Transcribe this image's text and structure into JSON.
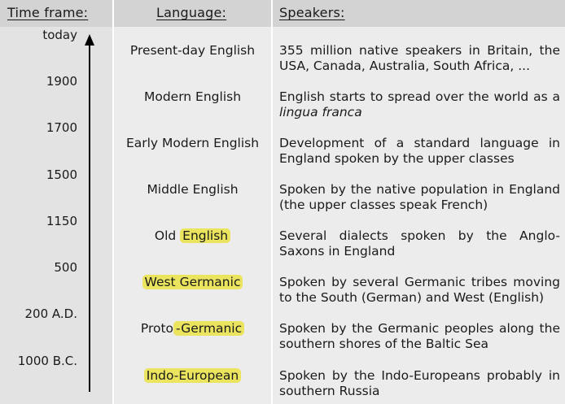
{
  "header": {
    "time_frame": "Time frame:",
    "language": "Language:",
    "speakers": "Speakers:"
  },
  "timeline": [
    "today",
    "1900",
    "1700",
    "1500",
    "1150",
    "500",
    "200 A.D.",
    "1000 B.C."
  ],
  "rows": [
    {
      "language_pre": "Present-day English",
      "language_hl": "",
      "speakers_line1": "355 million native speakers in Britain, the",
      "speakers_line2": "USA, Canada, Australia, South Africa, ..."
    },
    {
      "language_pre": "Modern English",
      "language_hl": "",
      "speakers_line1": "English starts to spread over the world as a",
      "speakers_line2": "lingua franca"
    },
    {
      "language_pre": "Early Modern English",
      "language_hl": "",
      "speakers_line1": "Development of a standard language in",
      "speakers_line2": "England spoken by the upper classes"
    },
    {
      "language_pre": "Middle English",
      "language_hl": "",
      "speakers_line1": "Spoken by the native population in England",
      "speakers_line2": "(the upper classes speak French)"
    },
    {
      "language_pre": "Old ",
      "language_hl": "English",
      "speakers_line1": "Several dialects spoken by the Anglo-",
      "speakers_line2": "Saxons in England"
    },
    {
      "language_pre": "",
      "language_hl": "West Germanic",
      "speakers_line1": "Spoken by several Germanic tribes moving",
      "speakers_line2": "to the South (German) and West (English)"
    },
    {
      "language_pre": "Proto",
      "language_hl": "-Germanic",
      "speakers_line1": "Spoken by the Germanic peoples along the",
      "speakers_line2": "southern shores of the Baltic Sea"
    },
    {
      "language_pre": "",
      "language_hl": "Indo-European",
      "speakers_line1": "Spoken by the Indo-Europeans probably in",
      "speakers_line2": "southern Russia"
    }
  ],
  "colors": {
    "highlight": "#ebe45e",
    "header_bg": "#d3d3d3",
    "time_col_bg": "#e3e3e3",
    "col_bg": "#ececec"
  }
}
